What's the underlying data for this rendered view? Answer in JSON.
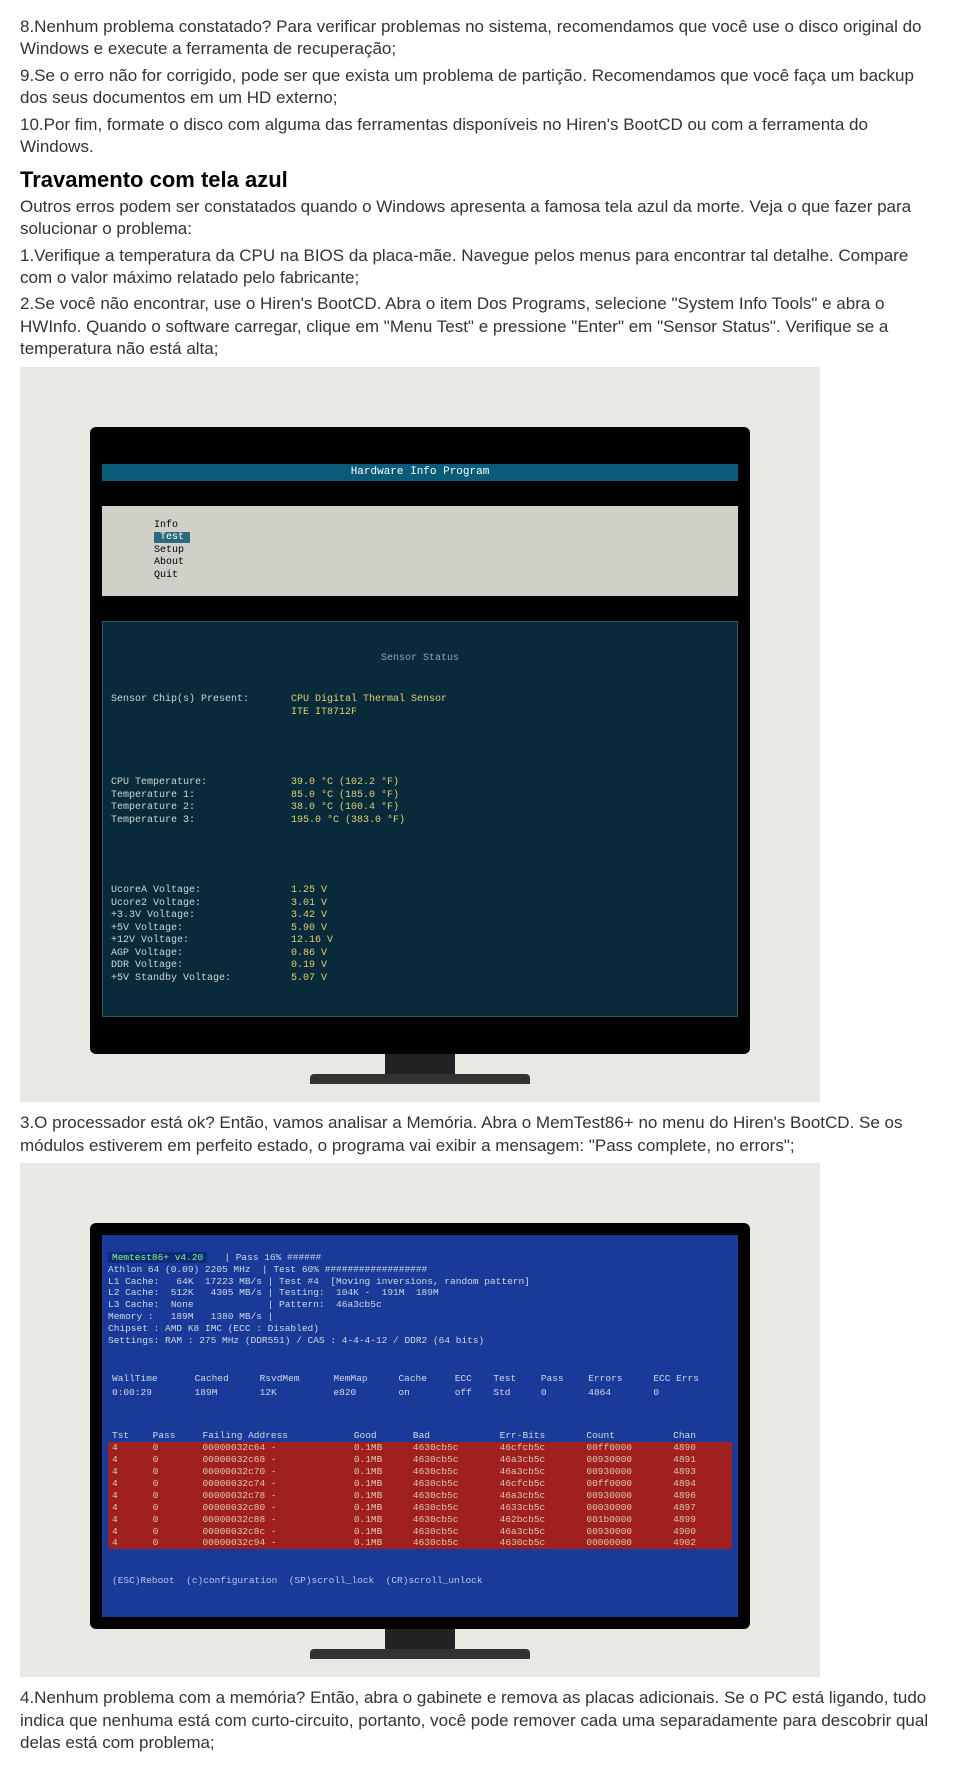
{
  "para1": "8.Nenhum problema constatado? Para verificar problemas no sistema, recomendamos que você use o disco original do Windows e execute a ferramenta de recuperação;",
  "para2": "9.Se o erro não for corrigido, pode ser que exista um problema de partição. Recomendamos que você faça um backup dos seus documentos em um HD externo;",
  "para3": "10.Por fim, formate o disco com alguma das ferramentas disponíveis no Hiren's BootCD ou com a ferramenta do Windows.",
  "heading1": "Travamento com tela azul",
  "para4": "Outros erros podem ser constatados quando o Windows apresenta a famosa tela azul da morte. Veja o que fazer para solucionar o problema:",
  "para5": "1.Verifique a temperatura da CPU na BIOS da placa-mãe. Navegue pelos menus para encontrar tal detalhe. Compare com o valor máximo relatado pelo fabricante;",
  "para6": "2.Se você não encontrar, use o Hiren's BootCD. Abra o item Dos Programs, selecione \"System Info Tools\" e abra o HWInfo. Quando o software carregar, clique em \"Menu Test\" e pressione \"Enter\" em \"Sensor Status\". Verifique se a temperatura não está alta;",
  "screenshot1": {
    "title": "Hardware Info Program",
    "menu": [
      "Info",
      "Test",
      "Setup",
      "About",
      "Quit"
    ],
    "menu_selected": "Test",
    "subtitle": "Sensor Status",
    "sensor_line_label": "Sensor Chip(s) Present:",
    "sensor_line_value": "CPU Digital Thermal Sensor\nITE IT8712F",
    "temps": [
      {
        "label": "CPU Temperature:",
        "value": "39.0 °C (102.2 °F)"
      },
      {
        "label": "Temperature 1:",
        "value": "85.0 °C (185.0 °F)"
      },
      {
        "label": "Temperature 2:",
        "value": "38.0 °C (100.4 °F)"
      },
      {
        "label": "Temperature 3:",
        "value": "195.0 °C (383.0 °F)"
      }
    ],
    "volts": [
      {
        "label": "UcoreA Voltage:",
        "value": "1.25 V"
      },
      {
        "label": "Ucore2 Voltage:",
        "value": "3.01 V"
      },
      {
        "label": "+3.3V Voltage:",
        "value": "3.42 V"
      },
      {
        "label": "+5V Voltage:",
        "value": "5.90 V"
      },
      {
        "label": "+12V Voltage:",
        "value": "12.16 V"
      },
      {
        "label": "AGP Voltage:",
        "value": "0.86 V"
      },
      {
        "label": "DDR Voltage:",
        "value": "0.19 V"
      },
      {
        "label": "+5V Standby Voltage:",
        "value": "5.07 V"
      }
    ]
  },
  "para7": "3.O processador está ok? Então, vamos analisar a Memória. Abra o MemTest86+ no menu do Hiren's BootCD. Se os módulos estiverem em perfeito estado, o programa vai exibir a mensagem: \"Pass complete, no errors\";",
  "screenshot2": {
    "title": "Memtest86+ v4.20",
    "pass_line": "| Pass 16% ######",
    "cpu_line": "Athlon 64 (0.09) 2205 MHz  | Test 60% ##################",
    "l1": "L1 Cache:   64K  17223 MB/s | Test #4  [Moving inversions, random pattern]",
    "l2": "L2 Cache:  512K   4305 MB/s | Testing:  104K -  191M  189M",
    "l3": "L3 Cache:  None             | Pattern:  46a3cb5c",
    "mem": "Memory :   189M   1380 MB/s |",
    "chip": "Chipset : AMD K8 IMC (ECC : Disabled)",
    "set": "Settings: RAM : 275 MHz (DDR551) / CAS : 4-4-4-12 / DDR2 (64 bits)",
    "tbl_header1": [
      "WallTime",
      "Cached",
      "RsvdMem",
      "MemMap",
      "Cache",
      "ECC",
      "Test",
      "Pass",
      "Errors",
      "ECC Errs"
    ],
    "tbl_row1": [
      "0:00:29",
      "189M",
      "12K",
      "e820",
      "on",
      "off",
      "Std",
      "0",
      "4864",
      "0"
    ],
    "tbl_header2": [
      "Tst",
      "Pass",
      "Failing Address",
      "Good",
      "Bad",
      "Err-Bits",
      "Count",
      "Chan"
    ],
    "tbl_rows2": [
      [
        "4",
        "0",
        "00000032c64 -",
        "0.1MB",
        "4630cb5c",
        "46cfcb5c",
        "00ff0000",
        "4890",
        ""
      ],
      [
        "4",
        "0",
        "00000032c68 -",
        "0.1MB",
        "4630cb5c",
        "46a3cb5c",
        "00930000",
        "4891",
        ""
      ],
      [
        "4",
        "0",
        "00000032c70 -",
        "0.1MB",
        "4630cb5c",
        "46a3cb5c",
        "00930000",
        "4893",
        ""
      ],
      [
        "4",
        "0",
        "00000032c74 -",
        "0.1MB",
        "4630cb5c",
        "46cfcb5c",
        "00ff0000",
        "4894",
        ""
      ],
      [
        "4",
        "0",
        "00000032c78 -",
        "0.1MB",
        "4630cb5c",
        "46a3cb5c",
        "00930000",
        "4896",
        ""
      ],
      [
        "4",
        "0",
        "00000032c80 -",
        "0.1MB",
        "4630cb5c",
        "4633cb5c",
        "00030000",
        "4897",
        ""
      ],
      [
        "4",
        "0",
        "00000032c88 -",
        "0.1MB",
        "4630cb5c",
        "462bcb5c",
        "001b0000",
        "4899",
        ""
      ],
      [
        "4",
        "0",
        "00000032c8c -",
        "0.1MB",
        "4630cb5c",
        "46a3cb5c",
        "00930000",
        "4900",
        ""
      ],
      [
        "4",
        "0",
        "00000032c94 -",
        "0.1MB",
        "4630cb5c",
        "4630cb5c",
        "00000000",
        "4902",
        ""
      ]
    ],
    "footer": "(ESC)Reboot  (c)configuration  (SP)scroll_lock  (CR)scroll_unlock"
  },
  "para8": "4.Nenhum problema com a memória? Então, abra o gabinete e remova as placas adicionais. Se o PC está ligando, tudo indica que nenhuma está com curto-circuito, portanto, você pode remover cada uma separadamente para descobrir qual delas está com problema;"
}
